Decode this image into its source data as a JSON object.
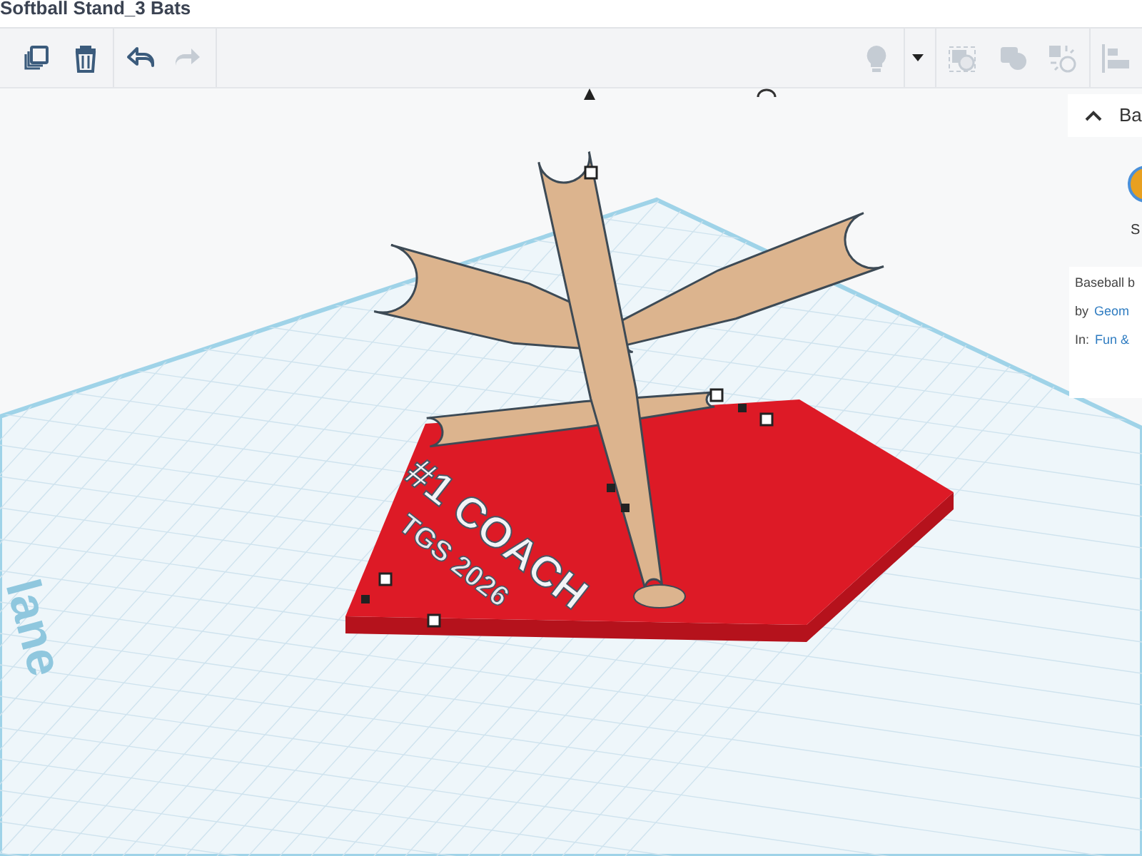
{
  "window": {
    "title": "Softball Stand_3 Bats"
  },
  "toolbar": {
    "left": [
      {
        "kind": "duplicate",
        "disabled": false
      },
      {
        "kind": "delete",
        "disabled": false
      },
      {
        "kind": "undo",
        "disabled": false
      },
      {
        "kind": "redo",
        "disabled": true
      }
    ],
    "right": [
      {
        "kind": "light",
        "disabled": true
      },
      {
        "kind": "dropdown"
      },
      {
        "kind": "group",
        "disabled": true
      },
      {
        "kind": "combine",
        "disabled": true
      },
      {
        "kind": "ungroup",
        "disabled": true
      },
      {
        "kind": "align",
        "disabled": true
      }
    ]
  },
  "workplane": {
    "label": "lane"
  },
  "model": {
    "texts": [
      "#1 COACH",
      "TGS 2026"
    ]
  },
  "panel": {
    "header": "Ba",
    "thumbnail_caption": "S",
    "info": {
      "title": "Baseball b",
      "author_prefix": "by",
      "author": "Geom",
      "category_prefix": "In:",
      "category": "Fun &"
    }
  }
}
